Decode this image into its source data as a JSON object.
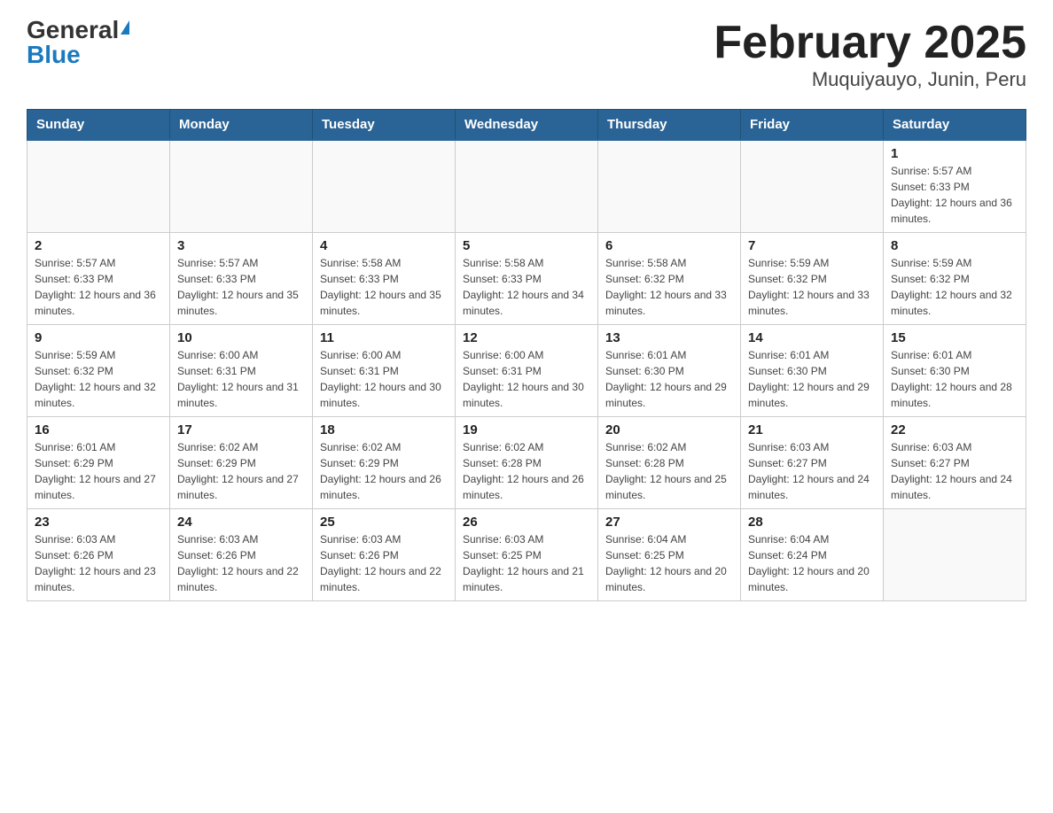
{
  "header": {
    "logo_general": "General",
    "logo_blue": "Blue",
    "title": "February 2025",
    "subtitle": "Muquiyauyo, Junin, Peru"
  },
  "weekdays": [
    "Sunday",
    "Monday",
    "Tuesday",
    "Wednesday",
    "Thursday",
    "Friday",
    "Saturday"
  ],
  "weeks": [
    [
      {
        "day": "",
        "sunrise": "",
        "sunset": "",
        "daylight": ""
      },
      {
        "day": "",
        "sunrise": "",
        "sunset": "",
        "daylight": ""
      },
      {
        "day": "",
        "sunrise": "",
        "sunset": "",
        "daylight": ""
      },
      {
        "day": "",
        "sunrise": "",
        "sunset": "",
        "daylight": ""
      },
      {
        "day": "",
        "sunrise": "",
        "sunset": "",
        "daylight": ""
      },
      {
        "day": "",
        "sunrise": "",
        "sunset": "",
        "daylight": ""
      },
      {
        "day": "1",
        "sunrise": "Sunrise: 5:57 AM",
        "sunset": "Sunset: 6:33 PM",
        "daylight": "Daylight: 12 hours and 36 minutes."
      }
    ],
    [
      {
        "day": "2",
        "sunrise": "Sunrise: 5:57 AM",
        "sunset": "Sunset: 6:33 PM",
        "daylight": "Daylight: 12 hours and 36 minutes."
      },
      {
        "day": "3",
        "sunrise": "Sunrise: 5:57 AM",
        "sunset": "Sunset: 6:33 PM",
        "daylight": "Daylight: 12 hours and 35 minutes."
      },
      {
        "day": "4",
        "sunrise": "Sunrise: 5:58 AM",
        "sunset": "Sunset: 6:33 PM",
        "daylight": "Daylight: 12 hours and 35 minutes."
      },
      {
        "day": "5",
        "sunrise": "Sunrise: 5:58 AM",
        "sunset": "Sunset: 6:33 PM",
        "daylight": "Daylight: 12 hours and 34 minutes."
      },
      {
        "day": "6",
        "sunrise": "Sunrise: 5:58 AM",
        "sunset": "Sunset: 6:32 PM",
        "daylight": "Daylight: 12 hours and 33 minutes."
      },
      {
        "day": "7",
        "sunrise": "Sunrise: 5:59 AM",
        "sunset": "Sunset: 6:32 PM",
        "daylight": "Daylight: 12 hours and 33 minutes."
      },
      {
        "day": "8",
        "sunrise": "Sunrise: 5:59 AM",
        "sunset": "Sunset: 6:32 PM",
        "daylight": "Daylight: 12 hours and 32 minutes."
      }
    ],
    [
      {
        "day": "9",
        "sunrise": "Sunrise: 5:59 AM",
        "sunset": "Sunset: 6:32 PM",
        "daylight": "Daylight: 12 hours and 32 minutes."
      },
      {
        "day": "10",
        "sunrise": "Sunrise: 6:00 AM",
        "sunset": "Sunset: 6:31 PM",
        "daylight": "Daylight: 12 hours and 31 minutes."
      },
      {
        "day": "11",
        "sunrise": "Sunrise: 6:00 AM",
        "sunset": "Sunset: 6:31 PM",
        "daylight": "Daylight: 12 hours and 30 minutes."
      },
      {
        "day": "12",
        "sunrise": "Sunrise: 6:00 AM",
        "sunset": "Sunset: 6:31 PM",
        "daylight": "Daylight: 12 hours and 30 minutes."
      },
      {
        "day": "13",
        "sunrise": "Sunrise: 6:01 AM",
        "sunset": "Sunset: 6:30 PM",
        "daylight": "Daylight: 12 hours and 29 minutes."
      },
      {
        "day": "14",
        "sunrise": "Sunrise: 6:01 AM",
        "sunset": "Sunset: 6:30 PM",
        "daylight": "Daylight: 12 hours and 29 minutes."
      },
      {
        "day": "15",
        "sunrise": "Sunrise: 6:01 AM",
        "sunset": "Sunset: 6:30 PM",
        "daylight": "Daylight: 12 hours and 28 minutes."
      }
    ],
    [
      {
        "day": "16",
        "sunrise": "Sunrise: 6:01 AM",
        "sunset": "Sunset: 6:29 PM",
        "daylight": "Daylight: 12 hours and 27 minutes."
      },
      {
        "day": "17",
        "sunrise": "Sunrise: 6:02 AM",
        "sunset": "Sunset: 6:29 PM",
        "daylight": "Daylight: 12 hours and 27 minutes."
      },
      {
        "day": "18",
        "sunrise": "Sunrise: 6:02 AM",
        "sunset": "Sunset: 6:29 PM",
        "daylight": "Daylight: 12 hours and 26 minutes."
      },
      {
        "day": "19",
        "sunrise": "Sunrise: 6:02 AM",
        "sunset": "Sunset: 6:28 PM",
        "daylight": "Daylight: 12 hours and 26 minutes."
      },
      {
        "day": "20",
        "sunrise": "Sunrise: 6:02 AM",
        "sunset": "Sunset: 6:28 PM",
        "daylight": "Daylight: 12 hours and 25 minutes."
      },
      {
        "day": "21",
        "sunrise": "Sunrise: 6:03 AM",
        "sunset": "Sunset: 6:27 PM",
        "daylight": "Daylight: 12 hours and 24 minutes."
      },
      {
        "day": "22",
        "sunrise": "Sunrise: 6:03 AM",
        "sunset": "Sunset: 6:27 PM",
        "daylight": "Daylight: 12 hours and 24 minutes."
      }
    ],
    [
      {
        "day": "23",
        "sunrise": "Sunrise: 6:03 AM",
        "sunset": "Sunset: 6:26 PM",
        "daylight": "Daylight: 12 hours and 23 minutes."
      },
      {
        "day": "24",
        "sunrise": "Sunrise: 6:03 AM",
        "sunset": "Sunset: 6:26 PM",
        "daylight": "Daylight: 12 hours and 22 minutes."
      },
      {
        "day": "25",
        "sunrise": "Sunrise: 6:03 AM",
        "sunset": "Sunset: 6:26 PM",
        "daylight": "Daylight: 12 hours and 22 minutes."
      },
      {
        "day": "26",
        "sunrise": "Sunrise: 6:03 AM",
        "sunset": "Sunset: 6:25 PM",
        "daylight": "Daylight: 12 hours and 21 minutes."
      },
      {
        "day": "27",
        "sunrise": "Sunrise: 6:04 AM",
        "sunset": "Sunset: 6:25 PM",
        "daylight": "Daylight: 12 hours and 20 minutes."
      },
      {
        "day": "28",
        "sunrise": "Sunrise: 6:04 AM",
        "sunset": "Sunset: 6:24 PM",
        "daylight": "Daylight: 12 hours and 20 minutes."
      },
      {
        "day": "",
        "sunrise": "",
        "sunset": "",
        "daylight": ""
      }
    ]
  ]
}
